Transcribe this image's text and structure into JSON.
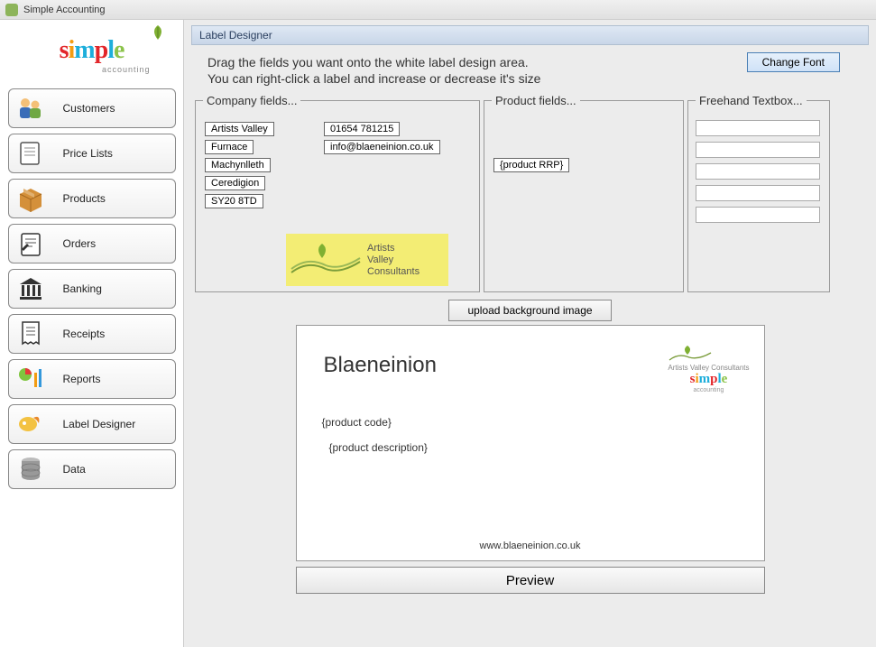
{
  "window": {
    "title": "Simple Accounting"
  },
  "logo": {
    "brand": "simple",
    "sub": "accounting"
  },
  "sidebar": {
    "items": [
      {
        "label": "Customers"
      },
      {
        "label": "Price Lists"
      },
      {
        "label": "Products"
      },
      {
        "label": "Orders"
      },
      {
        "label": "Banking"
      },
      {
        "label": "Receipts"
      },
      {
        "label": "Reports"
      },
      {
        "label": "Label Designer"
      },
      {
        "label": "Data"
      }
    ]
  },
  "content": {
    "header": "Label Designer",
    "instructions_line1": "Drag the fields you want onto the white label design area.",
    "instructions_line2": "You can right-click a label and increase or decrease it's size",
    "change_font_label": "Change Font",
    "company_legend": "Company fields...",
    "product_legend": "Product fields...",
    "freehand_legend": "Freehand Textbox...",
    "company_fields": {
      "name": "Artists Valley",
      "addr1": "Furnace",
      "addr2": "Machynlleth",
      "addr3": "Ceredigion",
      "postcode": "SY20 8TD",
      "phone": "01654 781215",
      "email": "info@blaeneinion.co.uk"
    },
    "product_fields": {
      "rrp": "{product RRP}"
    },
    "consultant_logo": {
      "line1": "Artists",
      "line2": "Valley",
      "line3": "Consultants"
    },
    "upload_button": "upload background image",
    "preview_button": "Preview"
  },
  "design": {
    "title": "Blaeneinion",
    "logo_consultant": "Artists Valley Consultants",
    "field1": "{product code}",
    "field2": "{product description}",
    "url": "www.blaeneinion.co.uk"
  }
}
